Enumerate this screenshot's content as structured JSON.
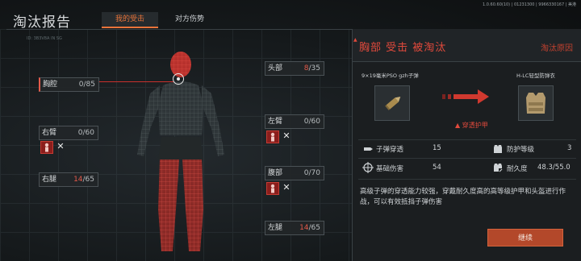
{
  "header": {
    "version": "1.0.60.60(10) | 01231300 | 9966330167 | 美港",
    "title": "淘汰报告",
    "sub_id": "ID: 3B3V8A IN SG",
    "tabs": [
      {
        "label": "我的受击",
        "active": true
      },
      {
        "label": "对方伤势",
        "active": false
      }
    ]
  },
  "body_parts": [
    {
      "key": "chest",
      "name": "胸腔",
      "current": "0",
      "max": "/85",
      "icons": []
    },
    {
      "key": "head",
      "name": "头部",
      "current": "8",
      "max": "/35",
      "icons": []
    },
    {
      "key": "right_arm",
      "name": "右臂",
      "current": "0",
      "max": "/60",
      "icons": [
        "bleed-icon",
        "fracture-icon"
      ]
    },
    {
      "key": "left_arm",
      "name": "左臂",
      "current": "0",
      "max": "/60",
      "icons": [
        "bleed-icon",
        "fracture-icon"
      ]
    },
    {
      "key": "right_leg",
      "name": "右腿",
      "current": "14",
      "max": "/65",
      "icons": []
    },
    {
      "key": "abdomen",
      "name": "腹部",
      "current": "0",
      "max": "/70",
      "icons": [
        "bleed-icon",
        "fracture-icon"
      ]
    },
    {
      "key": "left_leg",
      "name": "左腿",
      "current": "14",
      "max": "/65",
      "icons": []
    }
  ],
  "panel": {
    "cause": "胸部 受击 被淘汰",
    "reason_label": "淘汰原因",
    "ammo_name": "9×19毫米PSO gzh子弹",
    "armor_name": "H-LC轻型防弹衣",
    "penetrated_label": "穿透护甲",
    "stats": {
      "bullet_pen_label": "子弹穿透",
      "bullet_pen_value": "15",
      "base_damage_label": "基础伤害",
      "base_damage_value": "54",
      "armor_level_label": "防护等级",
      "armor_level_value": "3",
      "durability_label": "耐久度",
      "durability_value": "48.3/55.0"
    },
    "description": "高级子弹的穿透能力较强，穿戴耐久度高的高等级护甲和头盔进行作战，可以有效抵挡子弹伤害",
    "continue_label": "继续"
  },
  "colors": {
    "accent": "#e9743a",
    "damage": "#e45a4a",
    "button": "#b3482a"
  }
}
